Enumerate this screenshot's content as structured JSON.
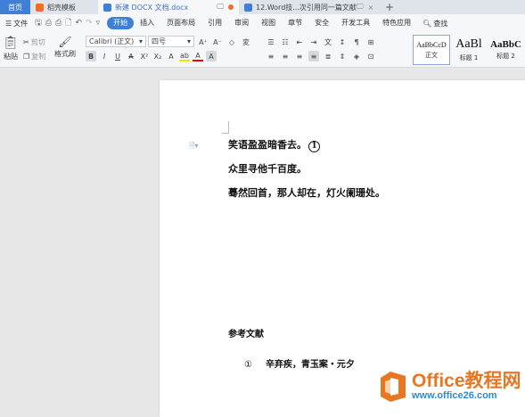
{
  "tabs": [
    {
      "label": "首页"
    },
    {
      "label": "稻壳模板"
    },
    {
      "label": "新建 DOCX 文档.docx"
    },
    {
      "label": "12.Word技...次引用同一篇文献"
    }
  ],
  "tab_plus": "+",
  "menu": {
    "file": "文件",
    "items": [
      "开始",
      "插入",
      "页面布局",
      "引用",
      "审阅",
      "视图",
      "章节",
      "安全",
      "开发工具",
      "特色应用"
    ],
    "active": "开始",
    "search": "查找"
  },
  "ribbon": {
    "paste": "粘贴",
    "cut": "剪切",
    "copy": "复制",
    "format_painter": "格式刷",
    "font_name": "Calibri (正文)",
    "font_size": "四号",
    "styles": [
      {
        "sample": "AaBbCcD",
        "name": "正文"
      },
      {
        "sample": "AaBl",
        "name": "标题 1"
      },
      {
        "sample": "AaBbC",
        "name": "标题 2"
      }
    ]
  },
  "document": {
    "lines": [
      "笑语盈盈暗香去。",
      "众里寻他千百度。",
      "蓦然回首，那人却在，灯火阑珊处。"
    ],
    "footnote_mark": "1",
    "ref_heading": "参考文献",
    "ref_num": "①",
    "ref_text": "辛弃疾，青玉案・元夕"
  },
  "watermark": {
    "title": "Office教程网",
    "url": "www.office26.com"
  },
  "colors": {
    "accent": "#3f7fd8",
    "orange": "#e87722",
    "blue_url": "#2f8ad0"
  }
}
